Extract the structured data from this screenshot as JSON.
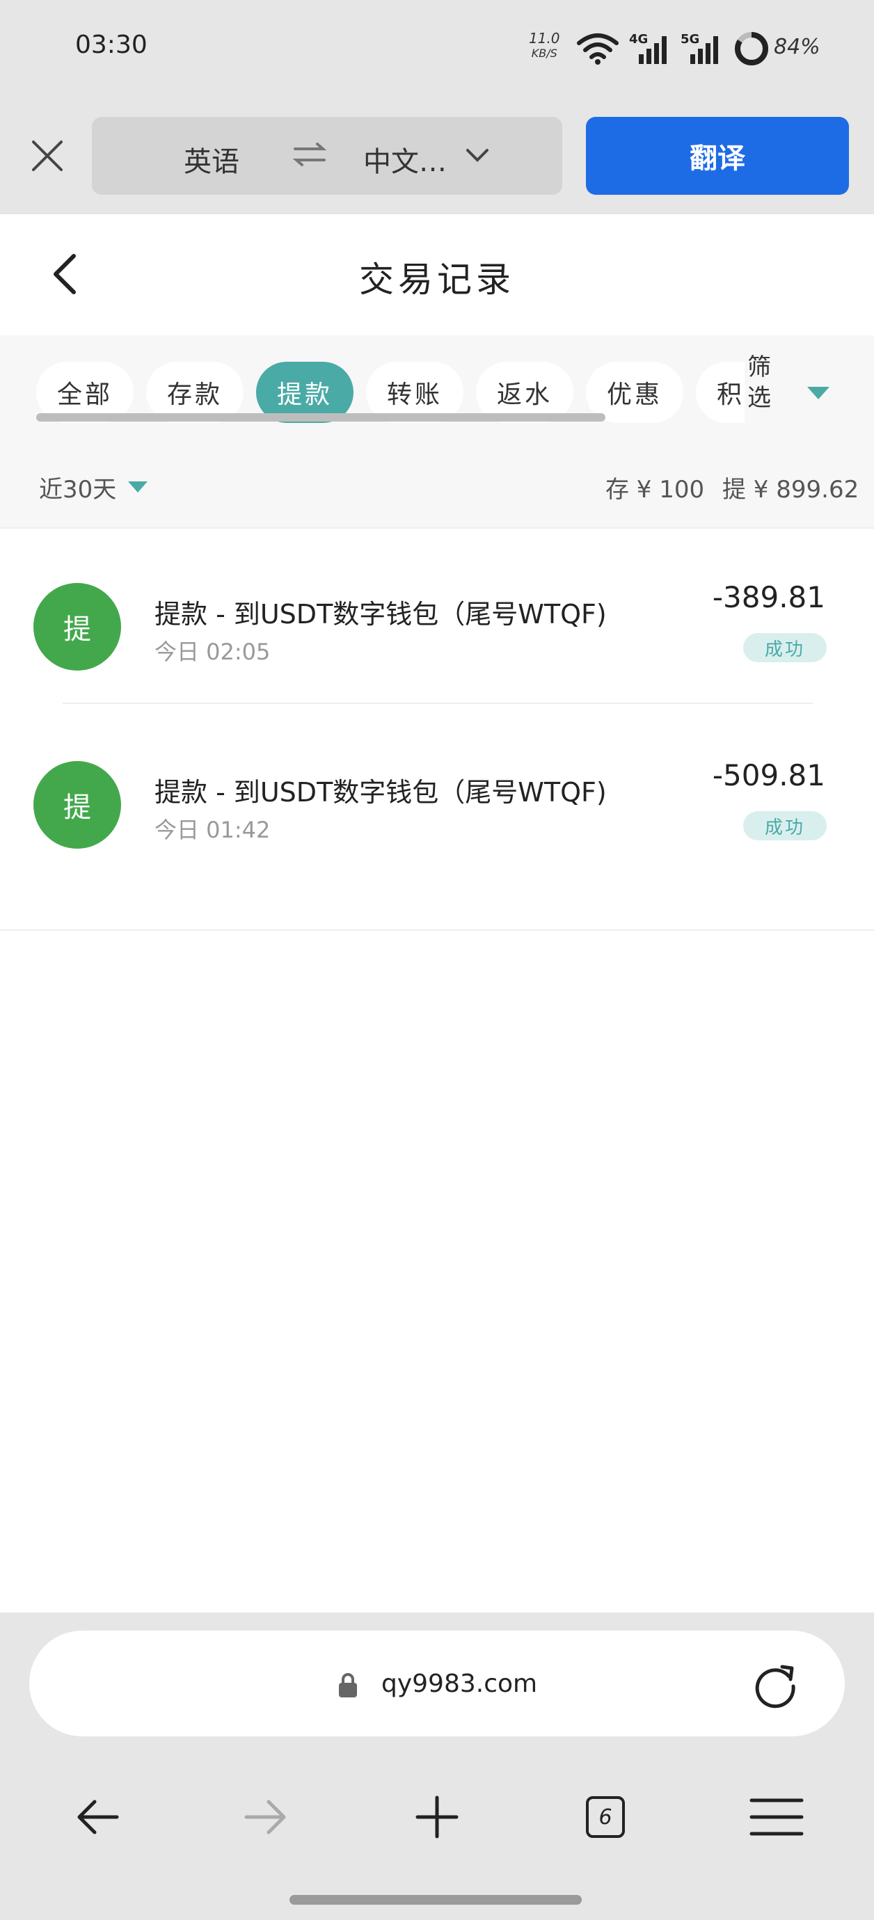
{
  "status_bar": {
    "time": "03:30",
    "net_speed": "11.0",
    "net_unit": "KB/S",
    "battery": "84%"
  },
  "translate_bar": {
    "source_lang": "英语",
    "target_lang": "中文…",
    "translate_label": "翻译"
  },
  "header": {
    "title": "交易记录"
  },
  "tabs": [
    {
      "label": "全部",
      "active": false
    },
    {
      "label": "存款",
      "active": false
    },
    {
      "label": "提款",
      "active": true
    },
    {
      "label": "转账",
      "active": false
    },
    {
      "label": "返水",
      "active": false
    },
    {
      "label": "优惠",
      "active": false
    },
    {
      "label": "积",
      "active": false
    }
  ],
  "filter_label": "筛选",
  "summary": {
    "range": "近30天",
    "deposit": "存 ¥ 100",
    "withdraw": "提 ¥ 899.62"
  },
  "transactions": [
    {
      "avatar": "提",
      "title": "提款 - 到USDT数字钱包（尾号WTQF)",
      "time": "今日 02:05",
      "amount": "-389.81",
      "status": "成功"
    },
    {
      "avatar": "提",
      "title": "提款 - 到USDT数字钱包（尾号WTQF)",
      "time": "今日 01:42",
      "amount": "-509.81",
      "status": "成功"
    }
  ],
  "browser": {
    "url": "qy9983.com",
    "tab_count": "6"
  },
  "colors": {
    "accent": "#4aaaa6",
    "avatar": "#43a84c",
    "translate_button": "#1e6be6"
  }
}
